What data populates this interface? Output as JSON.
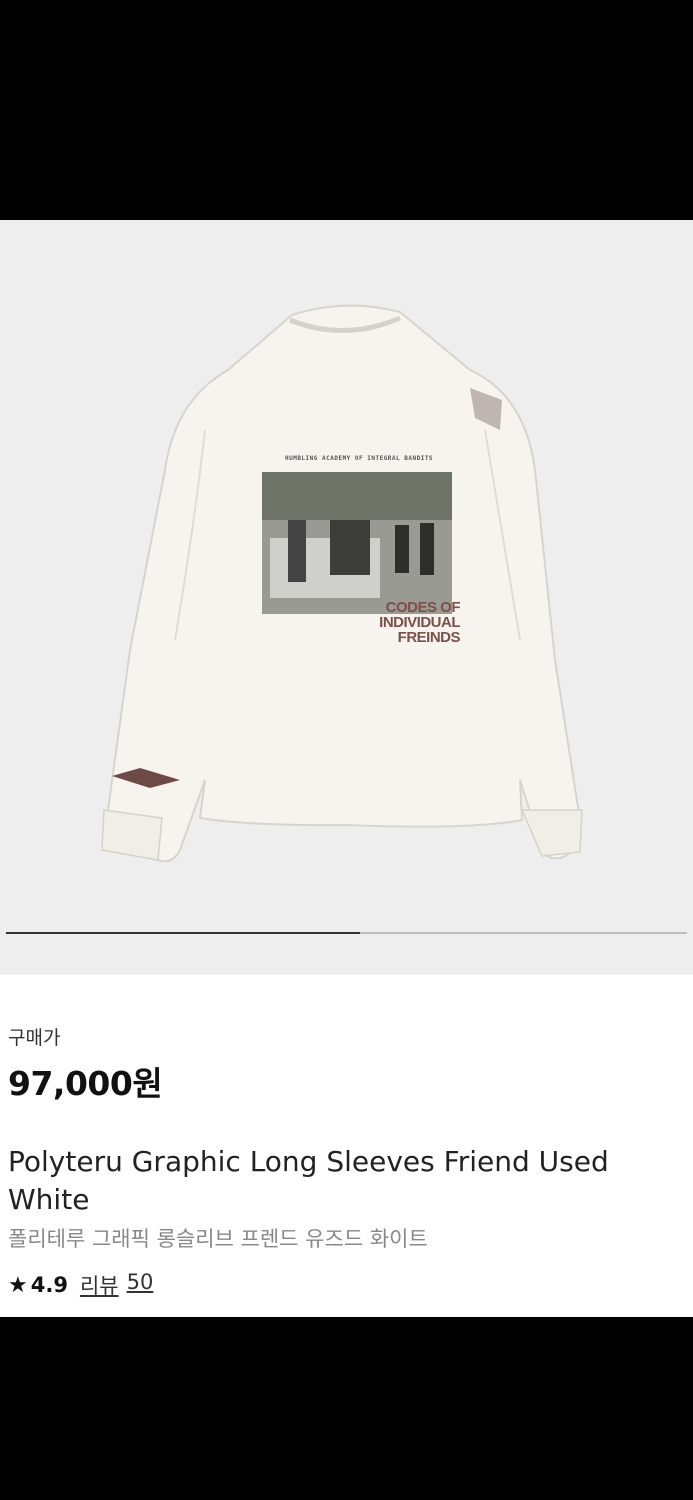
{
  "product": {
    "image_alt": "Polyteru graphic long sleeve t-shirt",
    "print": {
      "header": "HUMBLING ACADEMY OF INTEGRAL BANDITS",
      "line1": "CODES OF",
      "line2": "INDIVIDUAL",
      "line3": "FREINDS"
    },
    "carousel_progress": 0.52,
    "price_label": "구매가",
    "price": "97,000원",
    "title_en": "Polyteru Graphic Long Sleeves Friend Used White",
    "title_ko": "폴리테루 그래픽 롱슬리브 프렌드 유즈드 화이트",
    "rating": "4.9",
    "reviews_label": "리뷰",
    "reviews_count": "50"
  },
  "colors": {
    "background": "#eeeeee",
    "shirt": "#f7f4ef",
    "print_text": "#7a5048"
  }
}
